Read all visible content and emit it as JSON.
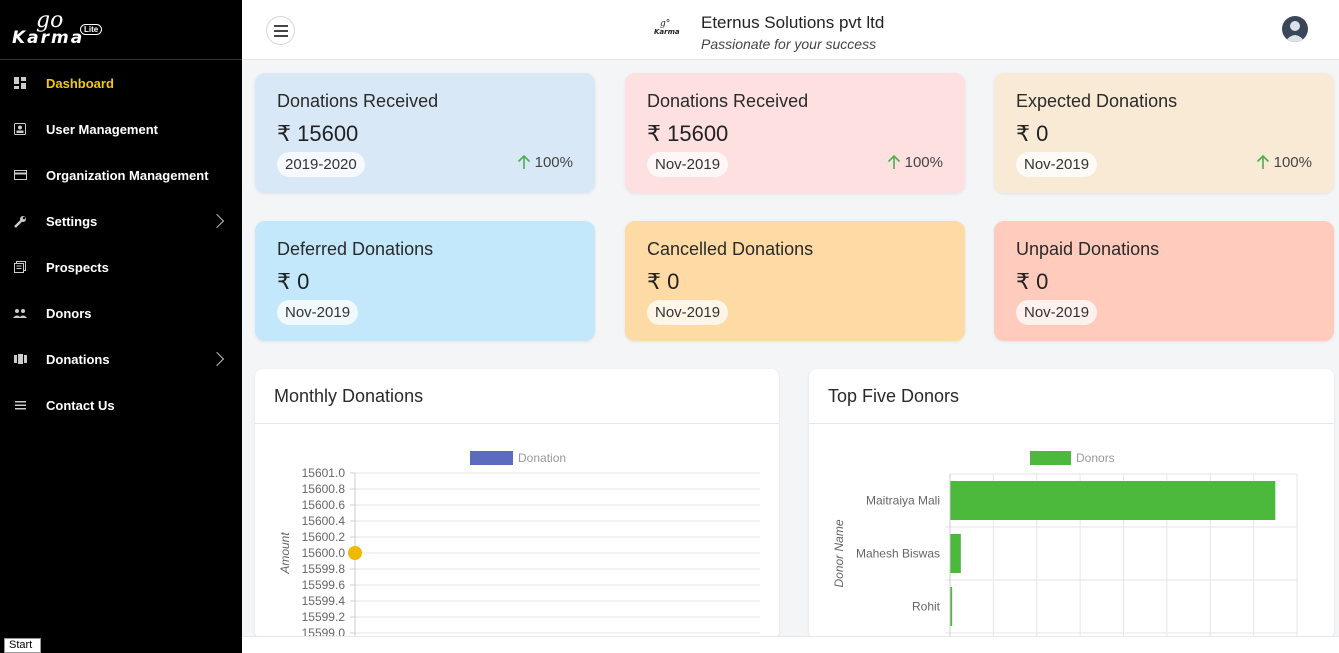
{
  "sidebar": {
    "logo": {
      "go": "go",
      "brand": "Karma",
      "badge": "Lite"
    },
    "items": [
      {
        "label": "Dashboard",
        "icon": "dashboard-icon",
        "active": true
      },
      {
        "label": "User Management",
        "icon": "user-card-icon"
      },
      {
        "label": "Organization Management",
        "icon": "organization-icon"
      },
      {
        "label": "Settings",
        "icon": "wrench-icon",
        "expandable": true
      },
      {
        "label": "Prospects",
        "icon": "prospects-icon"
      },
      {
        "label": "Donors",
        "icon": "people-icon"
      },
      {
        "label": "Donations",
        "icon": "donations-icon",
        "expandable": true
      },
      {
        "label": "Contact Us",
        "icon": "list-icon"
      }
    ],
    "start_label": "Start"
  },
  "header": {
    "company": "Eternus Solutions pvt ltd",
    "tagline": "Passionate for your success",
    "brand_logo_text": "goKarma"
  },
  "cards": [
    {
      "title": "Donations Received",
      "amount": "₹ 15600",
      "period": "2019-2020",
      "pct": "100%",
      "trend": "up",
      "bg": "#d9e8f7"
    },
    {
      "title": "Donations Received",
      "amount": "₹ 15600",
      "period": "Nov-2019",
      "pct": "100%",
      "trend": "up",
      "bg": "#fde0df"
    },
    {
      "title": "Expected Donations",
      "amount": "₹ 0",
      "period": "Nov-2019",
      "pct": "100%",
      "trend": "up",
      "bg": "#f9ead6"
    },
    {
      "title": "Deferred Donations",
      "amount": "₹ 0",
      "period": "Nov-2019",
      "bg": "#c4e8fb"
    },
    {
      "title": "Cancelled Donations",
      "amount": "₹ 0",
      "period": "Nov-2019",
      "bg": "#fedaa4"
    },
    {
      "title": "Unpaid Donations",
      "amount": "₹ 0",
      "period": "Nov-2019",
      "bg": "#fecbbc"
    }
  ],
  "panels": {
    "monthly": {
      "title": "Monthly Donations"
    },
    "top_donors": {
      "title": "Top Five Donors"
    }
  },
  "colors": {
    "accent": "#f5c518",
    "trend_up": "#4caf50",
    "donation_series": "#5b6bbf",
    "donors_series": "#4cb83c",
    "point": "#f0b800"
  },
  "chart_data": [
    {
      "type": "line",
      "series": [
        {
          "name": "Donation",
          "values": [
            15600
          ]
        }
      ],
      "x": [
        ""
      ],
      "ylabel": "Amount",
      "xlabel": "",
      "ylim": [
        15599.0,
        15601.0
      ],
      "yticks": [
        "15601.0",
        "15600.8",
        "15600.6",
        "15600.4",
        "15600.2",
        "15600.0",
        "15599.8",
        "15599.6",
        "15599.4",
        "15599.2",
        "15599.0"
      ],
      "legend": "top"
    },
    {
      "type": "bar",
      "orientation": "horizontal",
      "series": [
        {
          "name": "Donors",
          "values": [
            15000,
            500,
            100
          ]
        }
      ],
      "categories": [
        "Maitraiya Mali",
        "Mahesh Biswas",
        "Rohit"
      ],
      "ylabel": "Donor Name",
      "xlabel": "",
      "xlim": [
        0,
        16000
      ],
      "legend": "top"
    }
  ]
}
